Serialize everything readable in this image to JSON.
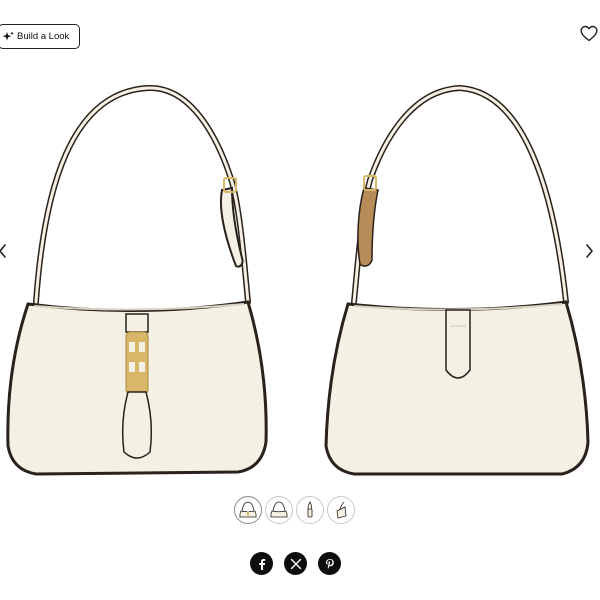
{
  "toolbar": {
    "build_look_label": "Build a Look",
    "build_look_icon": "sparkle-icon",
    "wishlist_icon": "heart-outline-icon"
  },
  "gallery": {
    "prev_icon": "chevron-left-icon",
    "next_icon": "chevron-right-icon",
    "images": [
      "bag-front-view",
      "bag-back-view"
    ],
    "thumbnail_count": 4,
    "active_thumbnail": 1
  },
  "share": {
    "icons": [
      "facebook-icon",
      "x-icon",
      "pinterest-icon"
    ]
  },
  "colors": {
    "bag_body": "#f4f0e4",
    "bag_trim": "#2a211c",
    "hardware_gold": "#d8b868",
    "tab_tan": "#b88c58",
    "share_button": "#0d0d0d"
  }
}
